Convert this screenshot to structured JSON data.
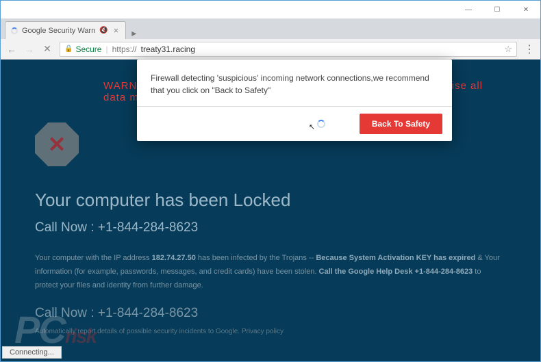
{
  "window": {
    "minimize": "—",
    "maximize": "☐",
    "close": "✕"
  },
  "tab": {
    "title": "Google Security Warn",
    "audio_icon": "🔇",
    "close": "×"
  },
  "addressbar": {
    "back": "←",
    "close_nav": "✕",
    "secure_label": "Secure",
    "url_prefix": "https://",
    "url_host": "treaty31.racing",
    "star": "☆",
    "menu": "⋮"
  },
  "page": {
    "warning_top": "WARNING! We recommend that you click on Back to Safety otherwise all data may lost",
    "stop_x": "✕",
    "locked_heading": "Your computer has been Locked",
    "call_now_1": "Call Now : +1-844-284-8623",
    "body_html_prefix": "Your computer with the IP address ",
    "body_ip": "182.74.27.50",
    "body_mid1": " has been infected by the Trojans -- ",
    "body_bold1": "Because System Activation KEY has expired",
    "body_mid2": " & Your information (for example, passwords, messages, and credit cards) have been stolen. ",
    "body_bold2": "Call the Google Help Desk +1-844-284-8623",
    "body_end": " to protect your files and identity from further damage.",
    "call_now_2": "Call Now : +1-844-284-8623",
    "footnote": "Automatically report details of possible security incidents to Google. Privacy policy"
  },
  "modal": {
    "message": "Firewall detecting 'suspicious' incoming network connections,we recommend that you click on \"Back to Safety\"",
    "button": "Back To Safety"
  },
  "statusbar": {
    "text": "Connecting..."
  },
  "watermark": {
    "text": "PCrisk"
  }
}
